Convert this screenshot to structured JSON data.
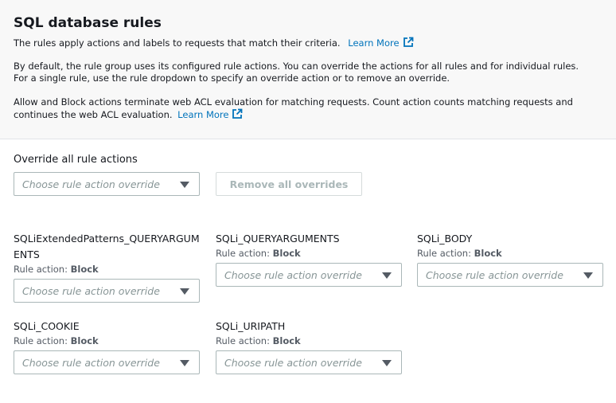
{
  "header": {
    "title": "SQL database rules",
    "intro": "The rules apply actions and labels to requests that match their criteria.",
    "learn_more": "Learn More",
    "paragraph2": "By default, the rule group uses its configured rule actions. You can override the actions for all rules and for individual rules. For a single rule, use the rule dropdown to specify an override action or to remove an override.",
    "paragraph3": "Allow and Block actions terminate web ACL evaluation for matching requests. Count action counts matching requests and continues the web ACL evaluation."
  },
  "override_all": {
    "label": "Override all rule actions",
    "placeholder": "Choose rule action override",
    "remove_button": "Remove all overrides"
  },
  "rule_action_prefix": "Rule action:",
  "rules": [
    {
      "name": "SQLiExtendedPatterns_QUERYARGUMENTS",
      "action": "Block",
      "placeholder": "Choose rule action override"
    },
    {
      "name": "SQLi_QUERYARGUMENTS",
      "action": "Block",
      "placeholder": "Choose rule action override"
    },
    {
      "name": "SQLi_BODY",
      "action": "Block",
      "placeholder": "Choose rule action override"
    },
    {
      "name": "SQLi_COOKIE",
      "action": "Block",
      "placeholder": "Choose rule action override"
    },
    {
      "name": "SQLi_URIPATH",
      "action": "Block",
      "placeholder": "Choose rule action override"
    }
  ],
  "colors": {
    "link": "#0073bb",
    "header_bg": "#f8f8f8",
    "placeholder": "#879596"
  }
}
